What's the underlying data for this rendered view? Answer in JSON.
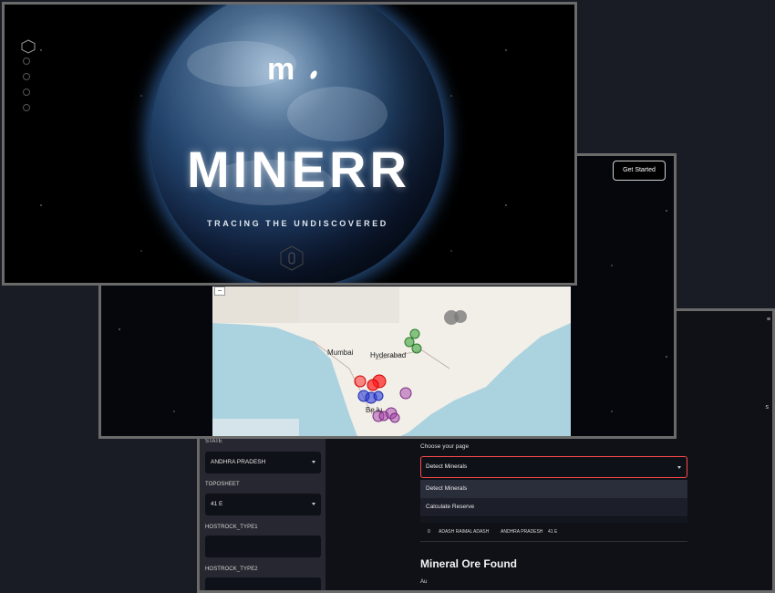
{
  "hero": {
    "title": "MINERR",
    "tagline": "TRACING THE UNDISCOVERED",
    "logo_text": "m",
    "scroll_label": "0",
    "nav_dots": [
      "",
      "",
      "",
      ""
    ]
  },
  "map_panel": {
    "get_started_label": "Get Started",
    "zoom_out_label": "−",
    "map_labels": {
      "mumbai": "Mumbai",
      "hyderabad": "Hyderabad",
      "bengaluru_partial": "Be   lu"
    },
    "cluster_colors": {
      "green": "#3ca33c",
      "red": "#ff1a1a",
      "blue": "#2a3bd6",
      "purple": "#a23ca8",
      "gray": "#7a7a7a"
    }
  },
  "app": {
    "sidebar": {
      "state_label": "STATE",
      "state_value": "ANDHRA PRADESH",
      "toposheet_label": "TOPOSHEET",
      "toposheet_value": "41 E",
      "hostrock1_label": "HOSTROCK_TYPE1",
      "hostrock1_value": "",
      "hostrock2_label": "HOSTROCK_TYPE2",
      "hostrock2_value": ""
    },
    "main": {
      "choose_label": "Choose your page",
      "page_select_value": "Detect Minerals",
      "options": [
        "Detect Minerals",
        "Calculate Reserve"
      ],
      "table_row": {
        "index": "0",
        "col1": "ADASH RAIMAL",
        "col2": "ADASH",
        "col3": "ANDHRA PRADESH",
        "col4": "41 E"
      },
      "result_title": "Mineral Ore Found",
      "result_value": "Au"
    },
    "menu_icon": "≡",
    "fragment_text": "s"
  }
}
